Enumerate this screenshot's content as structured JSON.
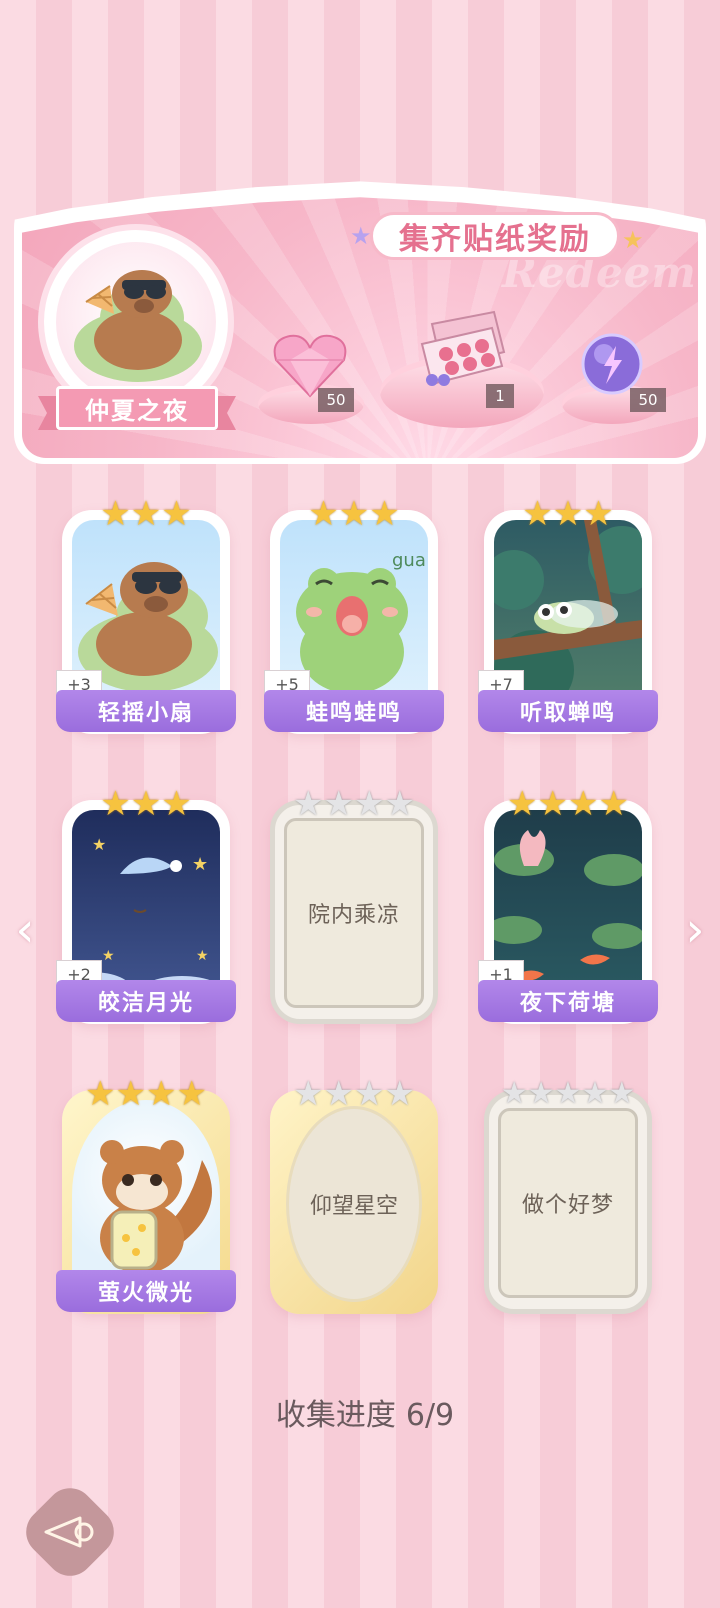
{
  "banner": {
    "title": "集齐贴纸奖励",
    "watermark": "Redeem",
    "collection_name": "仲夏之夜",
    "rewards": [
      {
        "icon": "pink-heart-gem-icon",
        "count": "50"
      },
      {
        "icon": "gift-box-icon",
        "count": "1"
      },
      {
        "icon": "purple-energy-orb-icon",
        "count": "50"
      }
    ]
  },
  "cards": [
    {
      "name": "轻摇小扇",
      "stars": 3,
      "unlocked": true,
      "plus": "+3",
      "icon": "capybara-fan-icon"
    },
    {
      "name": "蛙鸣蛙鸣",
      "stars": 3,
      "unlocked": true,
      "plus": "+5",
      "icon": "frog-gua-icon",
      "art_text": "gua"
    },
    {
      "name": "听取蝉鸣",
      "stars": 3,
      "unlocked": true,
      "plus": "+7",
      "icon": "cicada-branch-icon"
    },
    {
      "name": "皎洁月光",
      "stars": 3,
      "unlocked": true,
      "plus": "+2",
      "icon": "sleepy-moon-icon"
    },
    {
      "name": "院内乘凉",
      "stars": 4,
      "unlocked": false
    },
    {
      "name": "夜下荷塘",
      "stars": 4,
      "unlocked": true,
      "plus": "+1",
      "icon": "lotus-pond-koi-icon"
    },
    {
      "name": "萤火微光",
      "stars": 4,
      "unlocked": true,
      "icon": "squirrel-firefly-jar-icon"
    },
    {
      "name": "仰望星空",
      "stars": 4,
      "unlocked": false
    },
    {
      "name": "做个好梦",
      "stars": 5,
      "unlocked": false
    }
  ],
  "progress": {
    "label": "收集进度",
    "value": "6/9"
  },
  "nav": {
    "prev": "‹",
    "next": "›"
  },
  "colors": {
    "label_purple": "#9a6ddd",
    "star_gold": "#f6c33f",
    "star_silver": "#e4e4e6",
    "banner_pink": "#f3a6bb"
  }
}
